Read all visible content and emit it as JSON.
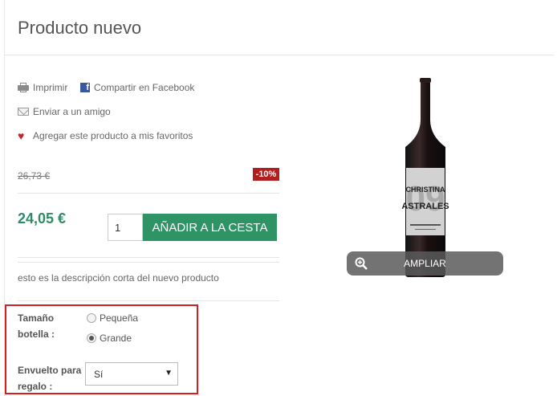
{
  "page": {
    "title": "Producto nuevo"
  },
  "actions": {
    "print": "Imprimir",
    "share_facebook": "Compartir en Facebook",
    "send_friend": "Enviar a un amigo",
    "add_favorites": "Agregar este producto a mis favoritos"
  },
  "pricing": {
    "old_price": "26,73 €",
    "discount": "-10%",
    "price": "24,05 €",
    "quantity": "1",
    "add_to_cart": "AÑADIR A LA CESTA"
  },
  "description": {
    "short": "esto es la descripción corta del nuevo producto"
  },
  "options": {
    "size_label_1": "Tamaño",
    "size_label_2": "botella :",
    "size_options": [
      "Pequeña",
      "Grande"
    ],
    "size_selected": "Grande",
    "gift_label_1": "Envuelto para",
    "gift_label_2": "regalo :",
    "gift_value": "Sí"
  },
  "image": {
    "zoom_label": "AMPLIAR",
    "bottle_label_line1": "CHRISTINA",
    "bottle_label_line2": "ASTRALES",
    "bottle_label_numeral": "09"
  },
  "colors": {
    "accent_green": "#2e9466",
    "price_green": "#2e8b66",
    "discount_red": "#b01e1e",
    "highlight_red": "#d21f1f"
  }
}
